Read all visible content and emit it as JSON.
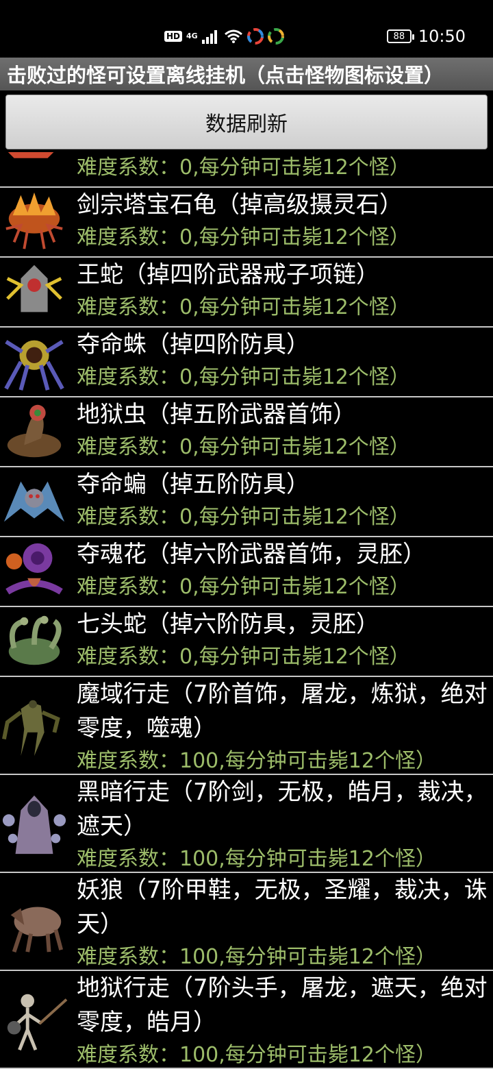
{
  "status_bar": {
    "hd_label": "HD",
    "network": "4G",
    "battery": "88",
    "time": "10:50",
    "icons": [
      "hd-icon",
      "signal-icon",
      "wifi-icon",
      "app-icon",
      "app-icon"
    ]
  },
  "header": {
    "title": "击败过的怪可设置离线挂机（点击怪物图标设置）"
  },
  "refresh_button": {
    "label": "数据刷新"
  },
  "monsters": [
    {
      "name": "",
      "difficulty": "难度系数：0,每分钟可击毙12个怪）",
      "icon": "monster-icon-partial",
      "color": "#6a2f8a"
    },
    {
      "name": "剑宗塔宝石龟（掉高级摄灵石）",
      "difficulty": "难度系数：0,每分钟可击毙12个怪）",
      "icon": "fire-turtle-icon",
      "color": "#c0541d"
    },
    {
      "name": "王蛇（掉四阶武器戒子项链）",
      "difficulty": "难度系数：0,每分钟可击毙12个怪）",
      "icon": "king-snake-icon",
      "color": "#8a8a8a"
    },
    {
      "name": "夺命蛛（掉四阶防具）",
      "difficulty": "难度系数：0,每分钟可击毙12个怪）",
      "icon": "spider-icon",
      "color": "#5a5ab8"
    },
    {
      "name": "地狱虫（掉五阶武器首饰）",
      "difficulty": "难度系数：0,每分钟可击毙12个怪）",
      "icon": "hell-worm-icon",
      "color": "#6a4a2a"
    },
    {
      "name": "夺命蝙（掉五阶防具）",
      "difficulty": "难度系数：0,每分钟可击毙12个怪）",
      "icon": "bat-icon",
      "color": "#5a8ab8"
    },
    {
      "name": "夺魂花（掉六阶武器首饰，灵胚）",
      "difficulty": "难度系数：0,每分钟可击毙12个怪）",
      "icon": "soul-flower-icon",
      "color": "#7a3aa0"
    },
    {
      "name": "七头蛇（掉六阶防具，灵胚）",
      "difficulty": "难度系数：0,每分钟可击毙12个怪）",
      "icon": "hydra-icon",
      "color": "#5a7a4a"
    },
    {
      "name": "魔域行走（7阶首饰，屠龙，炼狱，绝对零度，噬魂）",
      "difficulty": "难度系数：100,每分钟可击毙12个怪）",
      "icon": "demon-walker-icon",
      "color": "#6a6a3a"
    },
    {
      "name": "黑暗行走（7阶剑，无极，皓月，裁决，遮天）",
      "difficulty": "难度系数：100,每分钟可击毙12个怪）",
      "icon": "dark-walker-icon",
      "color": "#8a7a9a"
    },
    {
      "name": "妖狼（7阶甲鞋，无极，圣耀，裁决，诛天）",
      "difficulty": "难度系数：100,每分钟可击毙12个怪）",
      "icon": "demon-wolf-icon",
      "color": "#8a6a5a"
    },
    {
      "name": "地狱行走（7阶头手，屠龙，遮天，绝对零度，皓月）",
      "difficulty": "难度系数：100,每分钟可击毙12个怪）",
      "icon": "skeleton-icon",
      "color": "#c8c0b0"
    }
  ]
}
